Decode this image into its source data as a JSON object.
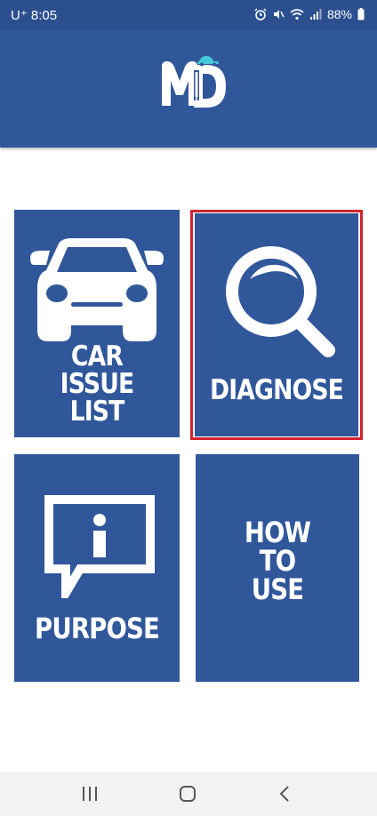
{
  "status_bar": {
    "carrier": "U⁺",
    "time": "8:05",
    "battery": "88%",
    "icons": [
      "alarm-icon",
      "mute-icon",
      "wifi-icon",
      "signal-icon",
      "battery-icon"
    ]
  },
  "header": {
    "logo_text": "MD",
    "background": "#30579a"
  },
  "tiles": [
    {
      "id": "car-issue-list",
      "label_lines": [
        "CAR",
        "ISSUE",
        "LIST"
      ],
      "icon": "car-icon"
    },
    {
      "id": "diagnose",
      "label": "DIAGNOSE",
      "icon": "magnifier-icon",
      "highlighted": true,
      "highlight_color": "#d3232e"
    },
    {
      "id": "purpose",
      "label": "PURPOSE",
      "icon": "info-speech-bubble-icon"
    },
    {
      "id": "how-to-use",
      "label_lines": [
        "HOW",
        "TO",
        "USE"
      ]
    }
  ],
  "nav_bar": {
    "buttons": [
      "recent-apps-icon",
      "home-icon",
      "back-icon"
    ]
  },
  "colors": {
    "primary": "#30579a",
    "status_bar": "#2c4f8f",
    "highlight": "#d3232e",
    "logo_accent": "#45c9d8"
  }
}
